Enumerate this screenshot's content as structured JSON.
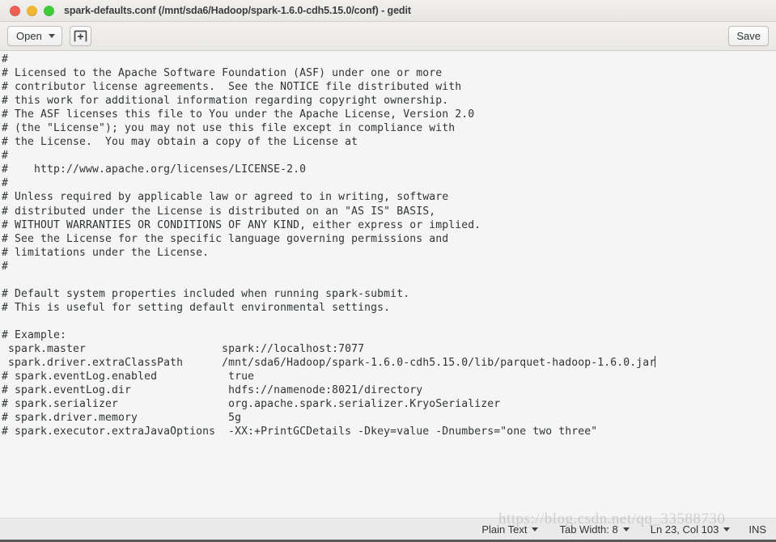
{
  "window": {
    "title": "spark-defaults.conf (/mnt/sda6/Hadoop/spark-1.6.0-cdh5.15.0/conf) - gedit",
    "controls": {
      "close": "close-button",
      "minimize": "minimize-button",
      "maximize": "maximize-button"
    },
    "colors": {
      "close": "#ed5f53",
      "minimize": "#f0b732",
      "maximize": "#3fcc3a",
      "titlebar_bg": "#eceae8",
      "toolbar_bg": "#eeedeb",
      "text_bg": "#f5f5f5",
      "text_fg": "#2f3436",
      "statusbar_bg": "#ebeaea"
    }
  },
  "toolbar": {
    "open_label": "Open",
    "open_caret": "chevron-down-icon",
    "new_document_icon": "new-document-icon",
    "save_label": "Save"
  },
  "document": {
    "file_name": "spark-defaults.conf",
    "lines": [
      "#",
      "# Licensed to the Apache Software Foundation (ASF) under one or more",
      "# contributor license agreements.  See the NOTICE file distributed with",
      "# this work for additional information regarding copyright ownership.",
      "# The ASF licenses this file to You under the Apache License, Version 2.0",
      "# (the \"License\"); you may not use this file except in compliance with",
      "# the License.  You may obtain a copy of the License at",
      "#",
      "#    http://www.apache.org/licenses/LICENSE-2.0",
      "#",
      "# Unless required by applicable law or agreed to in writing, software",
      "# distributed under the License is distributed on an \"AS IS\" BASIS,",
      "# WITHOUT WARRANTIES OR CONDITIONS OF ANY KIND, either express or implied.",
      "# See the License for the specific language governing permissions and",
      "# limitations under the License.",
      "#",
      "",
      "# Default system properties included when running spark-submit.",
      "# This is useful for setting default environmental settings.",
      "",
      "# Example:",
      " spark.master                     spark://localhost:7077",
      " spark.driver.extraClassPath      /mnt/sda6/Hadoop/spark-1.6.0-cdh5.15.0/lib/parquet-hadoop-1.6.0.jar",
      "# spark.eventLog.enabled           true",
      "# spark.eventLog.dir               hdfs://namenode:8021/directory",
      "# spark.serializer                 org.apache.spark.serializer.KryoSerializer",
      "# spark.driver.memory              5g",
      "# spark.executor.extraJavaOptions  -XX:+PrintGCDetails -Dkey=value -Dnumbers=\"one two three\""
    ],
    "caret_line_index": 22
  },
  "statusbar": {
    "language_label": "Plain Text",
    "language_caret": "chevron-down-icon",
    "tab_width_label": "Tab Width: 8",
    "tab_width_caret": "chevron-down-icon",
    "cursor_position": "Ln 23, Col 103",
    "cursor_caret": "chevron-down-icon",
    "insert_mode": "INS"
  },
  "watermark": {
    "text": "https://blog.csdn.net/qq_33588730"
  }
}
